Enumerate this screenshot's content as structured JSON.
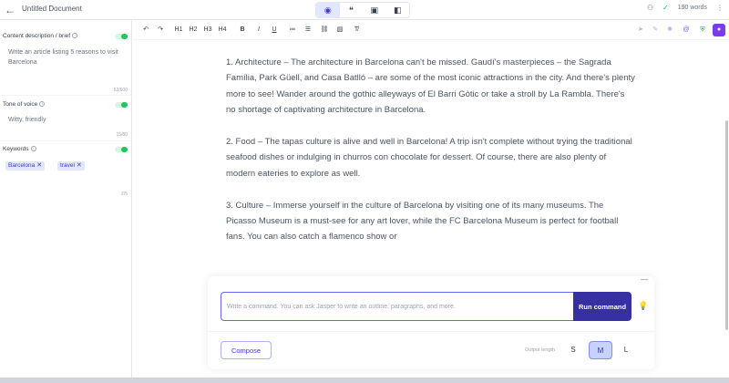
{
  "topbar": {
    "back_icon": "arrow-left-icon",
    "title": "Untitled Document",
    "views": [
      {
        "name": "preview-view",
        "icon": "eye-icon",
        "glyph": "◉"
      },
      {
        "name": "chat-view",
        "icon": "chat-icon",
        "glyph": "❝"
      },
      {
        "name": "template-view",
        "icon": "template-icon",
        "glyph": "▣"
      },
      {
        "name": "split-view",
        "icon": "split-icon",
        "glyph": "◧"
      }
    ],
    "word_count": "190 words"
  },
  "leftpanel": {
    "brief_label": "Content description / brief",
    "brief_value": "Write an article listing 5 reasons to visit Barcelona",
    "brief_counter": "52/600",
    "tone_label": "Tone of voice",
    "tone_value": "Witty, friendly",
    "tone_counter": "15/80",
    "keywords_label": "Keywords",
    "keywords": [
      "Barcelona",
      "travel"
    ],
    "keywords_counter": "2/5"
  },
  "toolbar": {
    "undo": "↶",
    "redo": "↷",
    "h1": "H1",
    "h2": "H2",
    "h3": "H3",
    "h4": "H4",
    "bold": "B",
    "italic": "I",
    "underline": "U",
    "ordered_list": "≔",
    "bullet_list": "☰",
    "link": "⛓",
    "image": "▨",
    "clear_format": "T̸"
  },
  "editor": {
    "p1": "1. Architecture – The architecture in Barcelona can't be missed. Gaudí's masterpieces – the Sagrada Família, Park Güell, and Casa Batlló – are some of the most iconic attractions in the city. And there's plenty more to see! Wander around the gothic alleyways of El Barri Gòtic or take a stroll by La Rambla. There's no shortage of captivating architecture in Barcelona.",
    "p2": "2. Food – The tapas culture is alive and well in Barcelona! A trip isn't complete without trying the traditional seafood dishes or indulging in churros con chocolate for dessert. Of course, there are also plenty of modern eateries to explore as well.",
    "p3": "3. Culture – Immerse yourself in the culture of Barcelona by visiting one of its many museums. The Picasso Museum is a must-see for any art lover, while the FC Barcelona Museum is perfect for football fans. You can also catch a flamenco show or"
  },
  "command": {
    "placeholder": "Write a command. You can ask Jasper to write an outline, paragraphs, and more.",
    "run_label": "Run command",
    "compose_label": "Compose",
    "length_label": "Output length",
    "lengths": [
      "S",
      "M",
      "L"
    ],
    "selected_length": "M"
  },
  "colors": {
    "accent": "#3730a3",
    "accent_light": "#e0e7ff",
    "toggle_on": "#22c55e"
  }
}
